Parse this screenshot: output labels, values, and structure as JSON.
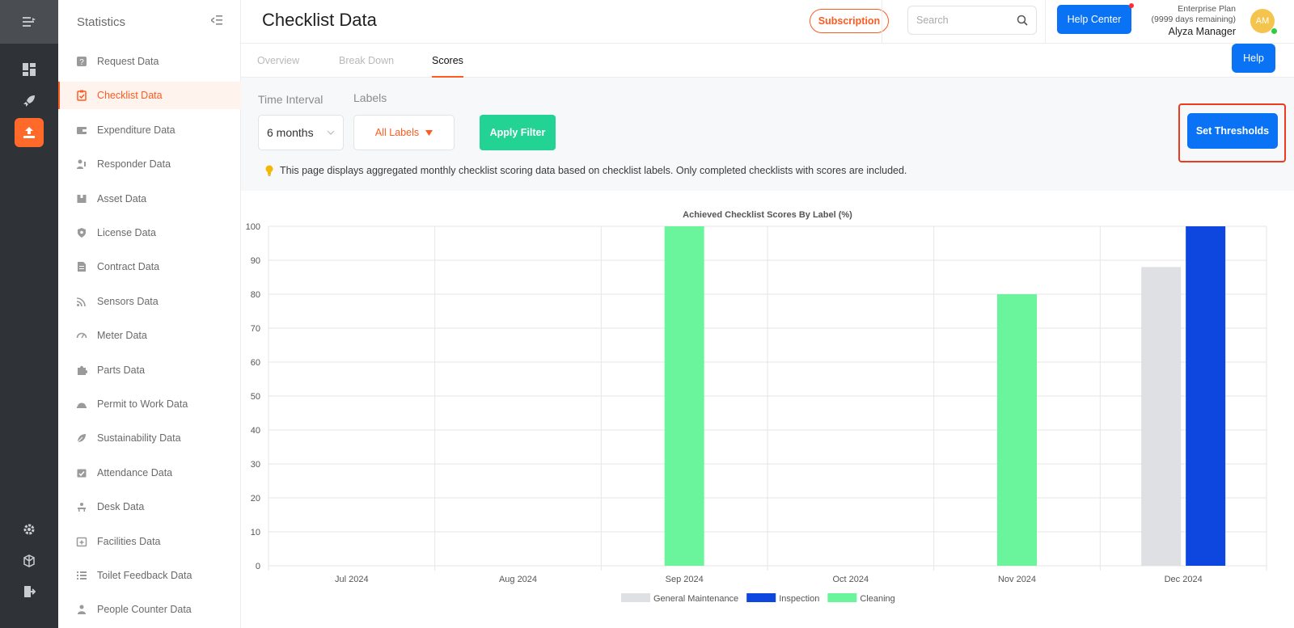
{
  "sidebar": {
    "title": "Statistics",
    "items": [
      {
        "label": "Request Data",
        "icon": "question-icon"
      },
      {
        "label": "Checklist Data",
        "icon": "clipboard-check-icon",
        "active": true
      },
      {
        "label": "Expenditure Data",
        "icon": "wallet-icon"
      },
      {
        "label": "Responder Data",
        "icon": "person-wrench-icon"
      },
      {
        "label": "Asset Data",
        "icon": "box-icon"
      },
      {
        "label": "License Data",
        "icon": "shield-icon"
      },
      {
        "label": "Contract Data",
        "icon": "document-icon"
      },
      {
        "label": "Sensors Data",
        "icon": "signal-icon"
      },
      {
        "label": "Meter Data",
        "icon": "gauge-icon"
      },
      {
        "label": "Parts Data",
        "icon": "puzzle-icon"
      },
      {
        "label": "Permit to Work Data",
        "icon": "hardhat-icon"
      },
      {
        "label": "Sustainability Data",
        "icon": "leaf-icon"
      },
      {
        "label": "Attendance Data",
        "icon": "calendar-check-icon"
      },
      {
        "label": "Desk Data",
        "icon": "desk-icon"
      },
      {
        "label": "Facilities Data",
        "icon": "calendar-plus-icon"
      },
      {
        "label": "Toilet Feedback Data",
        "icon": "list-icon"
      },
      {
        "label": "People Counter Data",
        "icon": "people-counter-icon"
      }
    ]
  },
  "header": {
    "title": "Checklist Data",
    "subscription_label": "Subscription",
    "search_placeholder": "Search",
    "help_center_label": "Help Center",
    "plan_name": "Enterprise Plan",
    "plan_remaining": "(9999 days remaining)",
    "user_name": "Alyza Manager",
    "avatar_initials": "AM"
  },
  "tabs": [
    {
      "label": "Overview"
    },
    {
      "label": "Break Down"
    },
    {
      "label": "Scores",
      "active": true
    }
  ],
  "help_label": "Help",
  "filters": {
    "time_interval_label": "Time Interval",
    "time_interval_value": "6 months",
    "labels_label": "Labels",
    "labels_value": "All Labels",
    "apply_label": "Apply Filter",
    "thresholds_label": "Set Thresholds",
    "info_text": "This page displays aggregated monthly checklist scoring data based on checklist labels. Only completed checklists with scores are included."
  },
  "colors": {
    "accent": "#ff5a1f",
    "primary_blue": "#0a72f5",
    "apply_green": "#22d394"
  },
  "chart_data": {
    "type": "bar",
    "title": "Achieved Checklist Scores By Label (%)",
    "categories": [
      "Jul 2024",
      "Aug 2024",
      "Sep 2024",
      "Oct 2024",
      "Nov 2024",
      "Dec 2024"
    ],
    "series": [
      {
        "name": "General Maintenance",
        "color": "#dfe0e3",
        "values": [
          null,
          null,
          null,
          null,
          null,
          88
        ]
      },
      {
        "name": "Inspection",
        "color": "#0d47e0",
        "values": [
          null,
          null,
          null,
          null,
          null,
          100
        ]
      },
      {
        "name": "Cleaning",
        "color": "#6af59c",
        "values": [
          null,
          null,
          100,
          null,
          80,
          null
        ]
      }
    ],
    "ylim": [
      0,
      100
    ],
    "yticks": [
      0,
      10,
      20,
      30,
      40,
      50,
      60,
      70,
      80,
      90,
      100
    ],
    "grid": true,
    "legend_position": "bottom"
  }
}
